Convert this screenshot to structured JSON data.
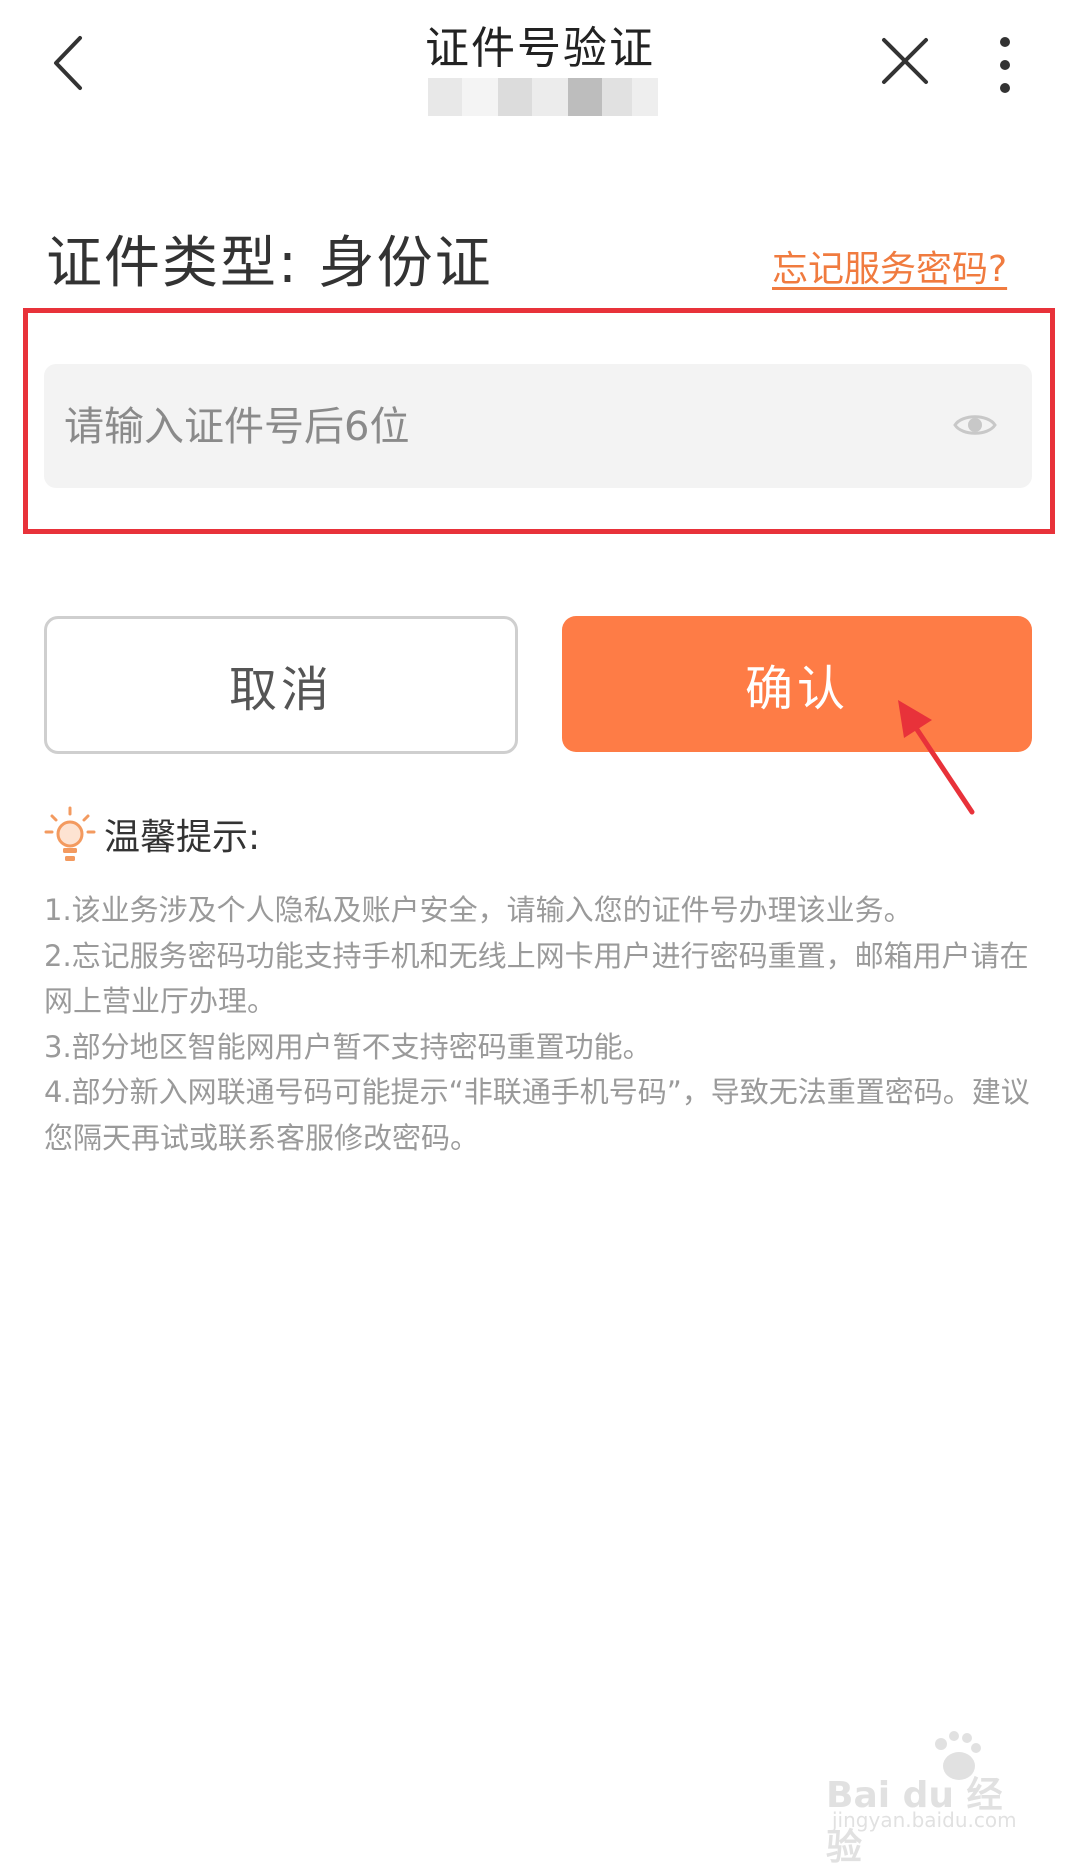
{
  "header": {
    "title": "证件号验证",
    "icons": {
      "back": "chevron-left-icon",
      "close": "close-icon",
      "more": "more-vertical-icon"
    }
  },
  "doc_type": {
    "label": "证件类型: 身份证"
  },
  "forgot_link": "忘记服务密码?",
  "id_input": {
    "placeholder": "请输入证件号后6位",
    "value": ""
  },
  "buttons": {
    "cancel": "取消",
    "confirm": "确认"
  },
  "tips": {
    "title": "温馨提示:",
    "lines": [
      "1.该业务涉及个人隐私及账户安全，请输入您的证件号办理该业务。",
      "2.忘记服务密码功能支持手机和无线上网卡用户进行密码重置，邮箱用户请在网上营业厅办理。",
      "3.部分地区智能网用户暂不支持密码重置功能。",
      "4.部分新入网联通号码可能提示“非联通手机号码”，导致无法重置密码。建议您隔天再试或联系客服修改密码。"
    ]
  },
  "watermark": {
    "brand": "Bai du 经验",
    "url": "jingyan.baidu.com"
  },
  "colors": {
    "accent": "#fe7c46",
    "link": "#f07b3f",
    "highlight": "#e8323a"
  }
}
